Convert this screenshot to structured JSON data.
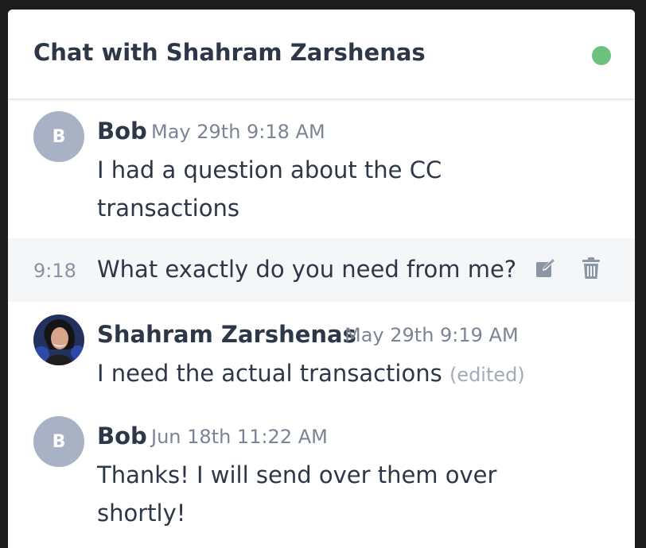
{
  "header": {
    "title": "Chat with Shahram Zarshenas",
    "status_color": "#6cc17f"
  },
  "messages": [
    {
      "avatar_initial": "B",
      "author": "Bob",
      "timestamp": "May 29th 9:18 AM",
      "text_line1": "I had a question about the CC",
      "text_line2": "transactions"
    },
    {
      "short_time": "9:18",
      "text": "What exactly do you need from me?",
      "icons": [
        "edit-icon",
        "trash-icon"
      ]
    },
    {
      "author": "Shahram Zarshenas",
      "timestamp": "May 29th 9:19 AM",
      "text": "I need the actual transactions",
      "edited_label": "(edited)"
    },
    {
      "avatar_initial": "B",
      "author": "Bob",
      "timestamp": "Jun 18th 11:22 AM",
      "text_line1": "Thanks! I will send over them over",
      "text_line2": "shortly!"
    }
  ]
}
